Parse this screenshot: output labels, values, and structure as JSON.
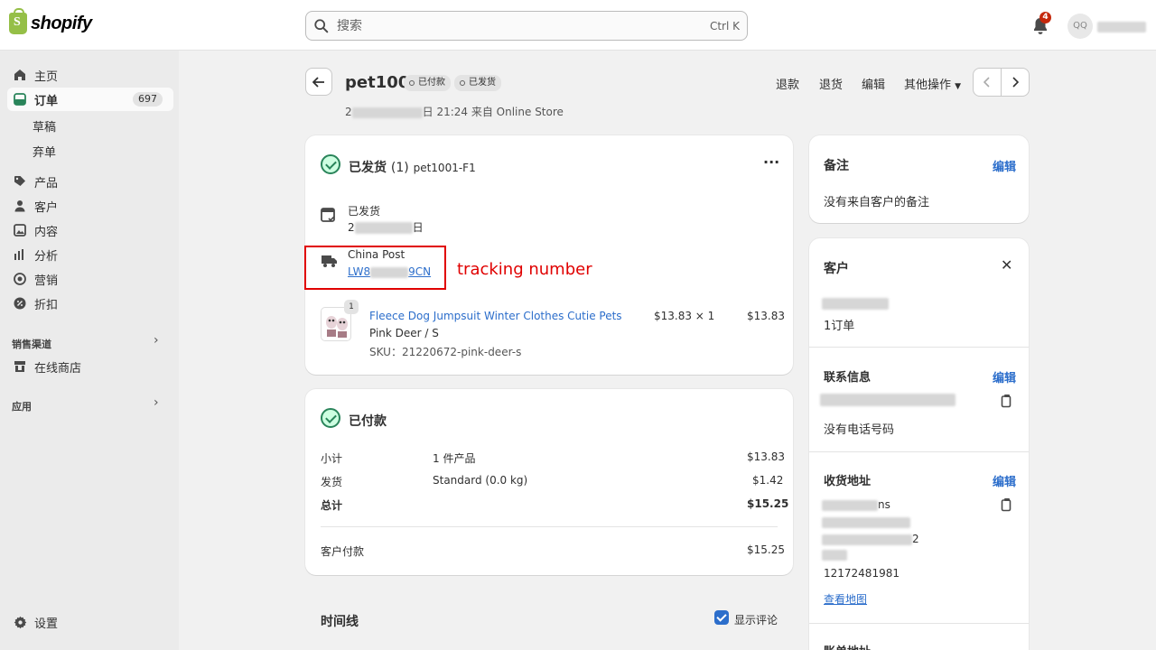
{
  "topbar": {
    "logo_text": "shopify",
    "search_placeholder": "搜索",
    "search_shortcut": "Ctrl K",
    "notification_count": "4",
    "avatar_initials": "QQ"
  },
  "sidebar": {
    "items": [
      {
        "label": "主页",
        "icon": "home-icon"
      },
      {
        "label": "订单",
        "icon": "orders-icon",
        "count": "697",
        "active": true
      },
      {
        "label": "草稿"
      },
      {
        "label": "弃单"
      },
      {
        "label": "产品",
        "icon": "tag-icon"
      },
      {
        "label": "客户",
        "icon": "person-icon"
      },
      {
        "label": "内容",
        "icon": "image-icon"
      },
      {
        "label": "分析",
        "icon": "chart-icon"
      },
      {
        "label": "营销",
        "icon": "target-icon"
      },
      {
        "label": "折扣",
        "icon": "discount-icon"
      }
    ],
    "section_sales": "销售渠道",
    "online_store": "在线商店",
    "section_apps": "应用",
    "settings": "设置"
  },
  "header": {
    "order_name": "pet1001",
    "badge_paid": "已付款",
    "badge_fulfilled": "已发货",
    "meta_prefix": "2",
    "meta_suffix": "日 21:24 来自 Online Store",
    "actions": {
      "refund": "退款",
      "return": "退货",
      "edit": "编辑",
      "more": "其他操作"
    }
  },
  "fulfillment": {
    "title": "已发货",
    "count": "(1)",
    "id": "pet1001-F1",
    "shipped_label": "已发货",
    "shipped_date_prefix": "2",
    "shipped_date_suffix": "日",
    "carrier": "China Post",
    "tracking_prefix": "LW8",
    "tracking_suffix": "9CN",
    "annotation": "tracking number",
    "item": {
      "qty_badge": "1",
      "title": "Fleece Dog Jumpsuit Winter Clothes Cutie Pets",
      "variant": "Pink Deer / S",
      "sku": "SKU：21220672-pink-deer-s",
      "unit_price": "$13.83 × 1",
      "total": "$13.83"
    }
  },
  "payment": {
    "title": "已付款",
    "rows": [
      {
        "label": "小计",
        "desc": "1 件产品",
        "amount": "$13.83"
      },
      {
        "label": "发货",
        "desc": "Standard (0.0 kg)",
        "amount": "$1.42"
      },
      {
        "label": "总计",
        "desc": "",
        "amount": "$15.25"
      }
    ],
    "paid_label": "客户付款",
    "paid_amount": "$15.25"
  },
  "timeline": {
    "title": "时间线",
    "show_comments": "显示评论"
  },
  "notes": {
    "title": "备注",
    "edit": "编辑",
    "empty": "没有来自客户的备注"
  },
  "customer": {
    "title": "客户",
    "orders": "1订单",
    "contact_title": "联系信息",
    "contact_edit": "编辑",
    "no_phone": "没有电话号码",
    "address_title": "收货地址",
    "address_edit": "编辑",
    "address_line1_suffix": "ns",
    "address_line3_suffix": "2",
    "phone": "12172481981",
    "view_map": "查看地图",
    "next_title": "账单地址"
  },
  "colors": {
    "accent": "#2c6ecb",
    "success": "#29845a",
    "annotation": "#e00000"
  }
}
